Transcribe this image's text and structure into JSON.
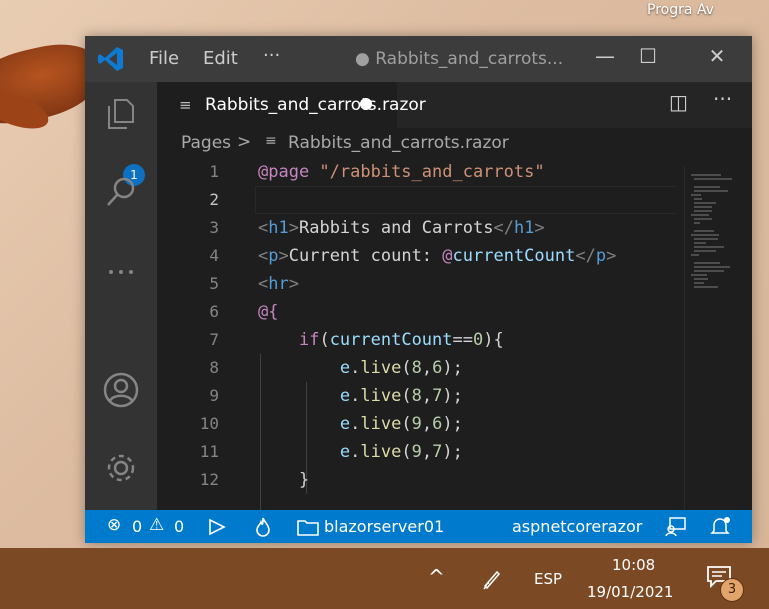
{
  "desktop": {
    "label": "Progra Av"
  },
  "window": {
    "menu": {
      "file": "File",
      "edit": "Edit",
      "more": "···"
    },
    "title": "● Rabbits_and_carrots...",
    "controls": {
      "minimize": "—",
      "maximize": "☐",
      "close": "✕"
    }
  },
  "activitybar": {
    "explorer_badge": "1",
    "icons": [
      "explorer-icon",
      "search-icon",
      "more-icon",
      "account-icon",
      "settings-gear-icon"
    ]
  },
  "tab": {
    "label": "Rabbits_and_carrots.razor",
    "icon": "≡"
  },
  "tab_actions": {
    "split": "◫",
    "more": "···"
  },
  "breadcrumb": {
    "folder": "Pages",
    "separator": ">",
    "file": "Rabbits_and_carrots.razor"
  },
  "editor": {
    "lines": [
      {
        "n": "1",
        "segments": [
          [
            "at",
            "@page "
          ],
          [
            "str",
            "\"/rabbits_and_carrots\""
          ]
        ]
      },
      {
        "n": "2",
        "segments": []
      },
      {
        "n": "3",
        "segments": [
          [
            "tag",
            "<"
          ],
          [
            "tname",
            "h1"
          ],
          [
            "tag",
            ">"
          ],
          [
            "txt",
            "Rabbits and Carrots"
          ],
          [
            "tag",
            "</"
          ],
          [
            "tname",
            "h1"
          ],
          [
            "tag",
            ">"
          ]
        ]
      },
      {
        "n": "4",
        "segments": [
          [
            "tag",
            "<"
          ],
          [
            "tname",
            "p"
          ],
          [
            "tag",
            ">"
          ],
          [
            "txt",
            "Current count: "
          ],
          [
            "at",
            "@"
          ],
          [
            "var",
            "currentCount"
          ],
          [
            "tag",
            "</"
          ],
          [
            "tname",
            "p"
          ],
          [
            "tag",
            ">"
          ]
        ]
      },
      {
        "n": "5",
        "segments": [
          [
            "tag",
            "<"
          ],
          [
            "tname",
            "hr"
          ],
          [
            "tag",
            ">"
          ]
        ]
      },
      {
        "n": "6",
        "segments": [
          [
            "at",
            "@{"
          ]
        ]
      },
      {
        "n": "7",
        "segments": [
          [
            "txt",
            "    "
          ],
          [
            "kw",
            "if"
          ],
          [
            "txt",
            "("
          ],
          [
            "var",
            "currentCount"
          ],
          [
            "txt",
            "=="
          ],
          [
            "num",
            "0"
          ],
          [
            "txt",
            "){"
          ]
        ]
      },
      {
        "n": "8",
        "segments": [
          [
            "txt",
            "        "
          ],
          [
            "var",
            "e"
          ],
          [
            "txt",
            "."
          ],
          [
            "fn",
            "live"
          ],
          [
            "txt",
            "("
          ],
          [
            "num",
            "8"
          ],
          [
            "txt",
            ","
          ],
          [
            "num",
            "6"
          ],
          [
            "txt",
            ");"
          ]
        ]
      },
      {
        "n": "9",
        "segments": [
          [
            "txt",
            "        "
          ],
          [
            "var",
            "e"
          ],
          [
            "txt",
            "."
          ],
          [
            "fn",
            "live"
          ],
          [
            "txt",
            "("
          ],
          [
            "num",
            "8"
          ],
          [
            "txt",
            ","
          ],
          [
            "num",
            "7"
          ],
          [
            "txt",
            ");"
          ]
        ]
      },
      {
        "n": "10",
        "segments": [
          [
            "txt",
            "        "
          ],
          [
            "var",
            "e"
          ],
          [
            "txt",
            "."
          ],
          [
            "fn",
            "live"
          ],
          [
            "txt",
            "("
          ],
          [
            "num",
            "9"
          ],
          [
            "txt",
            ","
          ],
          [
            "num",
            "6"
          ],
          [
            "txt",
            ");"
          ]
        ]
      },
      {
        "n": "11",
        "segments": [
          [
            "txt",
            "        "
          ],
          [
            "var",
            "e"
          ],
          [
            "txt",
            "."
          ],
          [
            "fn",
            "live"
          ],
          [
            "txt",
            "("
          ],
          [
            "num",
            "9"
          ],
          [
            "txt",
            ","
          ],
          [
            "num",
            "7"
          ],
          [
            "txt",
            ");"
          ]
        ]
      },
      {
        "n": "12",
        "segments": [
          [
            "txt",
            "    }"
          ]
        ]
      }
    ],
    "active_line": "2"
  },
  "statusbar": {
    "errors": "0",
    "warnings": "0",
    "project": "blazorserver01",
    "language": "aspnetcorerazor"
  },
  "taskbar": {
    "language": "ESP",
    "time": "10:08",
    "date": "19/01/2021",
    "notifications": "3"
  },
  "colors": {
    "accent": "#007acc",
    "titlebar": "#3c3c3c",
    "activitybar": "#333333",
    "editor_bg": "#1e1e1e",
    "taskbar": "#7b4a24"
  }
}
